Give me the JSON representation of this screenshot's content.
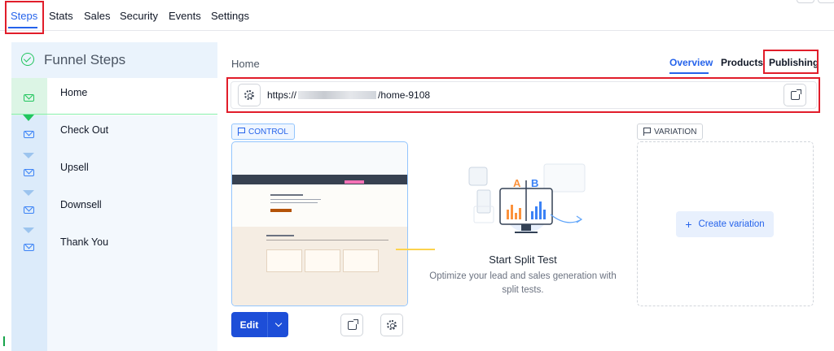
{
  "top_tabs": [
    {
      "label": "Steps",
      "active": true
    },
    {
      "label": "Stats",
      "active": false
    },
    {
      "label": "Sales",
      "active": false
    },
    {
      "label": "Security",
      "active": false
    },
    {
      "label": "Events",
      "active": false
    },
    {
      "label": "Settings",
      "active": false
    }
  ],
  "sidebar": {
    "title": "Funnel Steps",
    "steps": [
      {
        "label": "Home",
        "active": true
      },
      {
        "label": "Check Out",
        "active": false
      },
      {
        "label": "Upsell",
        "active": false
      },
      {
        "label": "Downsell",
        "active": false
      },
      {
        "label": "Thank You",
        "active": false
      }
    ]
  },
  "main": {
    "breadcrumb": "Home",
    "tabs": [
      {
        "label": "Overview",
        "active": true
      },
      {
        "label": "Products",
        "active": false
      },
      {
        "label": "Publishing",
        "active": false
      }
    ],
    "url": {
      "prefix": "https://",
      "suffix": "/home-9108"
    },
    "control_label": "CONTROL",
    "variation_label": "VARIATION",
    "split_test": {
      "title": "Start Split Test",
      "description": "Optimize your lead and sales generation with split tests."
    },
    "create_variation_label": "Create variation",
    "edit_label": "Edit",
    "illustration_letters": [
      "A",
      "B"
    ]
  },
  "colors": {
    "accent": "#2563eb",
    "highlight_red": "#e11d2a",
    "success_green": "#22c55e"
  }
}
